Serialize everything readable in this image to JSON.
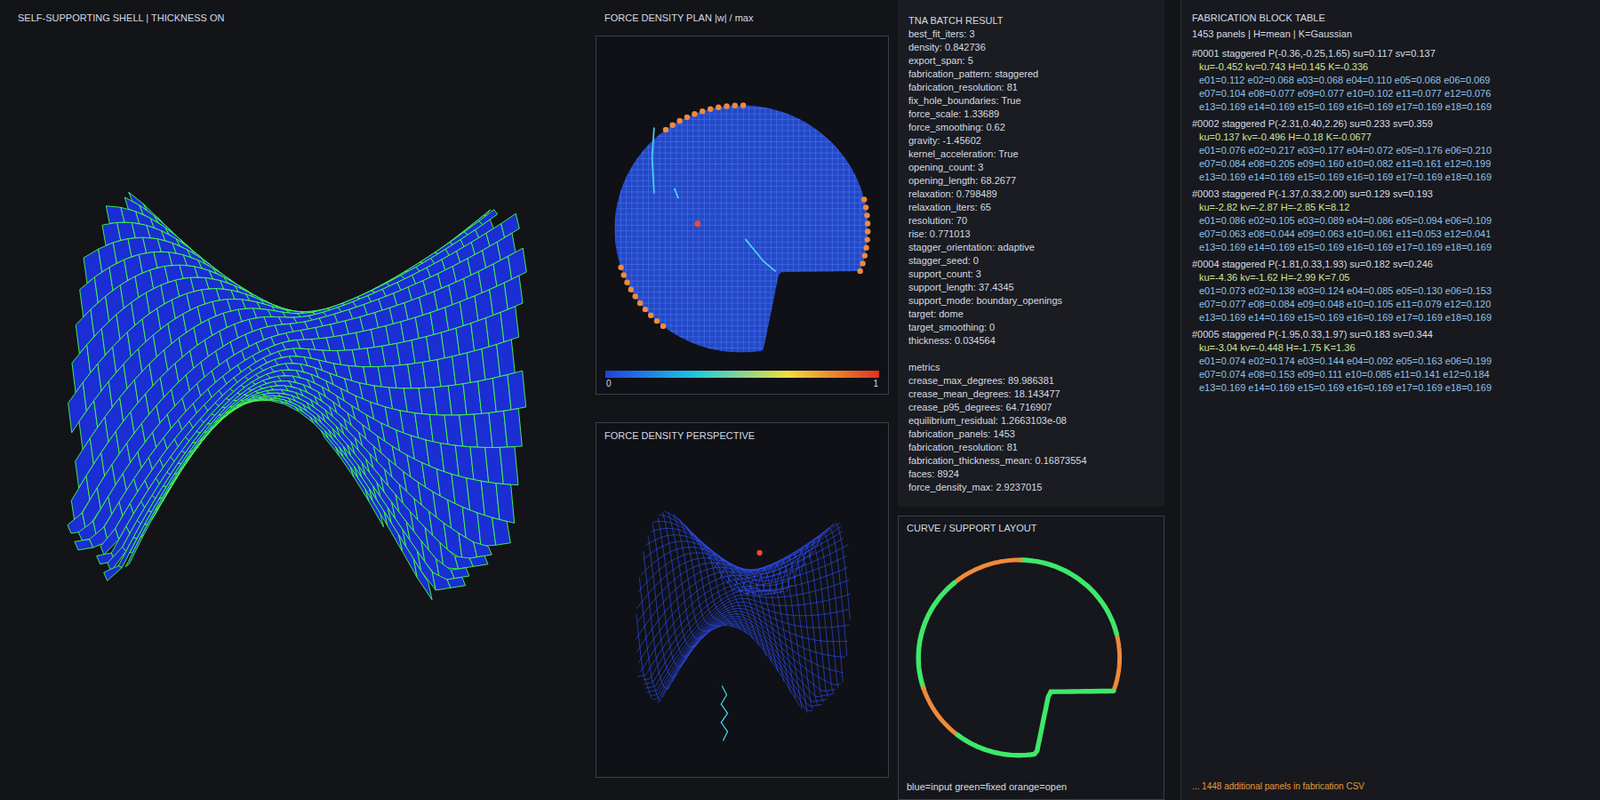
{
  "shell_view": {
    "title": "SELF-SUPPORTING SHELL | THICKNESS ON"
  },
  "plan_view": {
    "title": "FORCE DENSITY PLAN |w| / max",
    "scale_min": "0",
    "scale_max": "1"
  },
  "perspective_view": {
    "title": "FORCE DENSITY PERSPECTIVE"
  },
  "tna_result": {
    "title": "TNA BATCH RESULT",
    "params": [
      "best_fit_iters: 3",
      "density: 0.842736",
      "export_span: 5",
      "fabrication_pattern: staggered",
      "fabrication_resolution: 81",
      "fix_hole_boundaries: True",
      "force_scale: 1.33689",
      "force_smoothing: 0.62",
      "gravity: -1.45602",
      "kernel_acceleration: True",
      "opening_count: 3",
      "opening_length: 68.2677",
      "relaxation: 0.798489",
      "relaxation_iters: 65",
      "resolution: 70",
      "rise: 0.771013",
      "stagger_orientation: adaptive",
      "stagger_seed: 0",
      "support_count: 3",
      "support_length: 37.4345",
      "support_mode: boundary_openings",
      "target: dome",
      "target_smoothing: 0",
      "thickness: 0.034564"
    ],
    "metrics_title": "metrics",
    "metrics": [
      "crease_max_degrees: 89.986381",
      "crease_mean_degrees: 18.143477",
      "crease_p95_degrees: 64.716907",
      "equilibrium_residual: 1.2663103e-08",
      "fabrication_panels: 1453",
      "fabrication_resolution: 81",
      "fabrication_thickness_mean: 0.16873554",
      "faces: 8924",
      "force_density_max: 2.9237015"
    ]
  },
  "curve_layout": {
    "title": "CURVE / SUPPORT LAYOUT",
    "legend": "blue=input green=fixed orange=open",
    "segments": [
      {
        "kind": "open",
        "share": 0.1,
        "color": "#f08a3a"
      },
      {
        "kind": "fixed",
        "share": 0.22,
        "color": "#3ee86a"
      },
      {
        "kind": "open",
        "share": 0.12,
        "color": "#f08a3a"
      },
      {
        "kind": "fixed",
        "share": 0.2,
        "color": "#3ee86a"
      },
      {
        "kind": "open",
        "share": 0.1,
        "color": "#f08a3a"
      },
      {
        "kind": "fixed",
        "share": 0.26,
        "color": "#3ee86a"
      }
    ]
  },
  "fabrication_table": {
    "title": "FABRICATION BLOCK TABLE",
    "summary": "1453 panels | H=mean | K=Gaussian",
    "panels": [
      {
        "header": "#0001 staggered P(-0.36,-0.25,1.65) su=0.117 sv=0.137",
        "curvature": "ku=-0.452 kv=0.743 H=0.145 K=-0.336",
        "edges": [
          "e01=0.112 e02=0.068 e03=0.068 e04=0.110 e05=0.068 e06=0.069",
          "e07=0.104 e08=0.077 e09=0.077 e10=0.102 e11=0.077 e12=0.076",
          "e13=0.169 e14=0.169 e15=0.169 e16=0.169 e17=0.169 e18=0.169"
        ]
      },
      {
        "header": "#0002 staggered P(-2.31,0.40,2.26) su=0.233 sv=0.359",
        "curvature": "ku=0.137 kv=-0.496 H=-0.18 K=-0.0677",
        "edges": [
          "e01=0.076 e02=0.217 e03=0.177 e04=0.072 e05=0.176 e06=0.210",
          "e07=0.084 e08=0.205 e09=0.160 e10=0.082 e11=0.161 e12=0.199",
          "e13=0.169 e14=0.169 e15=0.169 e16=0.169 e17=0.169 e18=0.169"
        ]
      },
      {
        "header": "#0003 staggered P(-1.37,0.33,2.00) su=0.129 sv=0.193",
        "curvature": "ku=-2.82 kv=-2.87 H=-2.85 K=8.12",
        "edges": [
          "e01=0.086 e02=0.105 e03=0.089 e04=0.086 e05=0.094 e06=0.109",
          "e07=0.063 e08=0.044 e09=0.063 e10=0.061 e11=0.053 e12=0.041",
          "e13=0.169 e14=0.169 e15=0.169 e16=0.169 e17=0.169 e18=0.169"
        ]
      },
      {
        "header": "#0004 staggered P(-1.81,0.33,1.93) su=0.182 sv=0.246",
        "curvature": "ku=-4.36 kv=-1.62 H=-2.99 K=7.05",
        "edges": [
          "e01=0.073 e02=0.138 e03=0.124 e04=0.085 e05=0.130 e06=0.153",
          "e07=0.077 e08=0.084 e09=0.048 e10=0.105 e11=0.079 e12=0.120",
          "e13=0.169 e14=0.169 e15=0.169 e16=0.169 e17=0.169 e18=0.169"
        ]
      },
      {
        "header": "#0005 staggered P(-1.95,0.33,1.97) su=0.183 sv=0.344",
        "curvature": "ku=-3.04 kv=-0.448 H=-1.75 K=1.36",
        "edges": [
          "e01=0.074 e02=0.174 e03=0.144 e04=0.092 e05=0.163 e06=0.199",
          "e07=0.074 e08=0.153 e09=0.111 e10=0.085 e11=0.141 e12=0.184",
          "e13=0.169 e14=0.169 e15=0.169 e16=0.169 e17=0.169 e18=0.169"
        ]
      }
    ],
    "footer": "... 1448 additional panels in fabrication CSV"
  }
}
